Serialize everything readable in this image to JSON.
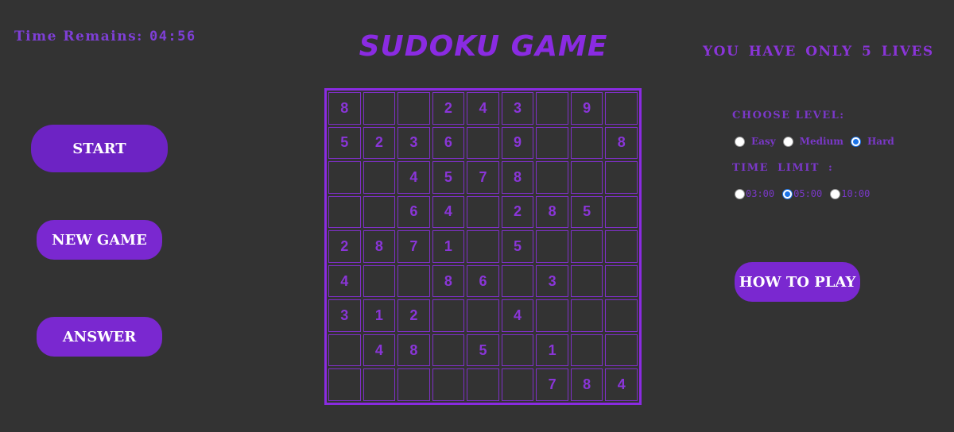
{
  "timer": {
    "label": "Time Remains:",
    "value": "04:56"
  },
  "title": "SUDOKU GAME",
  "lives_text": "YOU HAVE ONLY 5 LIVES",
  "buttons": {
    "start": "START",
    "new_game": "NEW GAME",
    "answer": "ANSWER",
    "how_to_play": "HOW TO PLAY"
  },
  "level": {
    "label": "CHOOSE LEVEL:",
    "options": [
      {
        "label": "Easy",
        "checked": false
      },
      {
        "label": "Medium",
        "checked": false
      },
      {
        "label": "Hard",
        "checked": true
      }
    ]
  },
  "time_limit": {
    "label": "TIME LIMIT :",
    "options": [
      {
        "label": "03:00",
        "checked": false
      },
      {
        "label": "05:00",
        "checked": true
      },
      {
        "label": "10:00",
        "checked": false
      }
    ]
  },
  "board": [
    [
      "8",
      "",
      "",
      "2",
      "4",
      "3",
      "",
      "9",
      ""
    ],
    [
      "5",
      "2",
      "3",
      "6",
      "",
      "9",
      "",
      "",
      "8"
    ],
    [
      "",
      "",
      "4",
      "5",
      "7",
      "8",
      "",
      "",
      ""
    ],
    [
      "",
      "",
      "6",
      "4",
      "",
      "2",
      "8",
      "5",
      ""
    ],
    [
      "2",
      "8",
      "7",
      "1",
      "",
      "5",
      "",
      "",
      ""
    ],
    [
      "4",
      "",
      "",
      "8",
      "6",
      "",
      "3",
      "",
      ""
    ],
    [
      "3",
      "1",
      "2",
      "",
      "",
      "4",
      "",
      "",
      ""
    ],
    [
      "",
      "4",
      "8",
      "",
      "5",
      "",
      "1",
      "",
      ""
    ],
    [
      "",
      "",
      "",
      "",
      "",
      "",
      "7",
      "8",
      "4"
    ]
  ],
  "colors": {
    "background": "#333333",
    "accent": "#8a2be2",
    "button": "#7a28d0"
  }
}
